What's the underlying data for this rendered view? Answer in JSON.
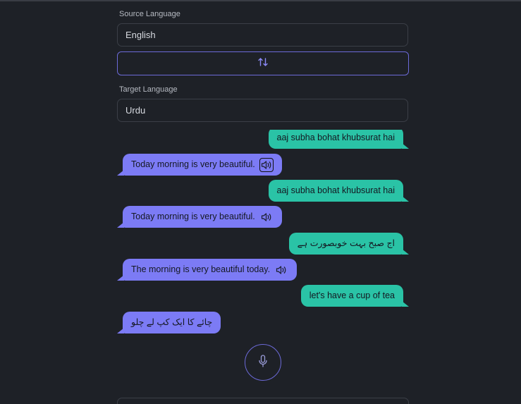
{
  "source": {
    "label": "Source Language",
    "value": "English"
  },
  "target": {
    "label": "Target Language",
    "value": "Urdu"
  },
  "icons": {
    "swap": "swap-vertical-icon",
    "speaker": "speaker-icon",
    "mic": "microphone-icon"
  },
  "colors": {
    "background": "#1e2127",
    "outgoing_bubble": "#2ac3a6",
    "incoming_bubble": "#7c7bf5",
    "accent_border": "#6c6ad8"
  },
  "messages": [
    {
      "role": "user",
      "text": "aaj subha bohat khubsurat hai"
    },
    {
      "role": "translation",
      "text": "Today morning is very beautiful."
    },
    {
      "role": "user",
      "text": "aaj subha bohat khubsurat hai"
    },
    {
      "role": "translation",
      "text": "Today morning is very beautiful."
    },
    {
      "role": "user",
      "text": "اج صبح بہت خوبصورت ہے"
    },
    {
      "role": "translation",
      "text": "The morning is very beautiful today."
    },
    {
      "role": "user",
      "text": "let's have a cup of tea"
    },
    {
      "role": "translation",
      "text": "چائے کا ایک کپ لے چلو"
    }
  ]
}
